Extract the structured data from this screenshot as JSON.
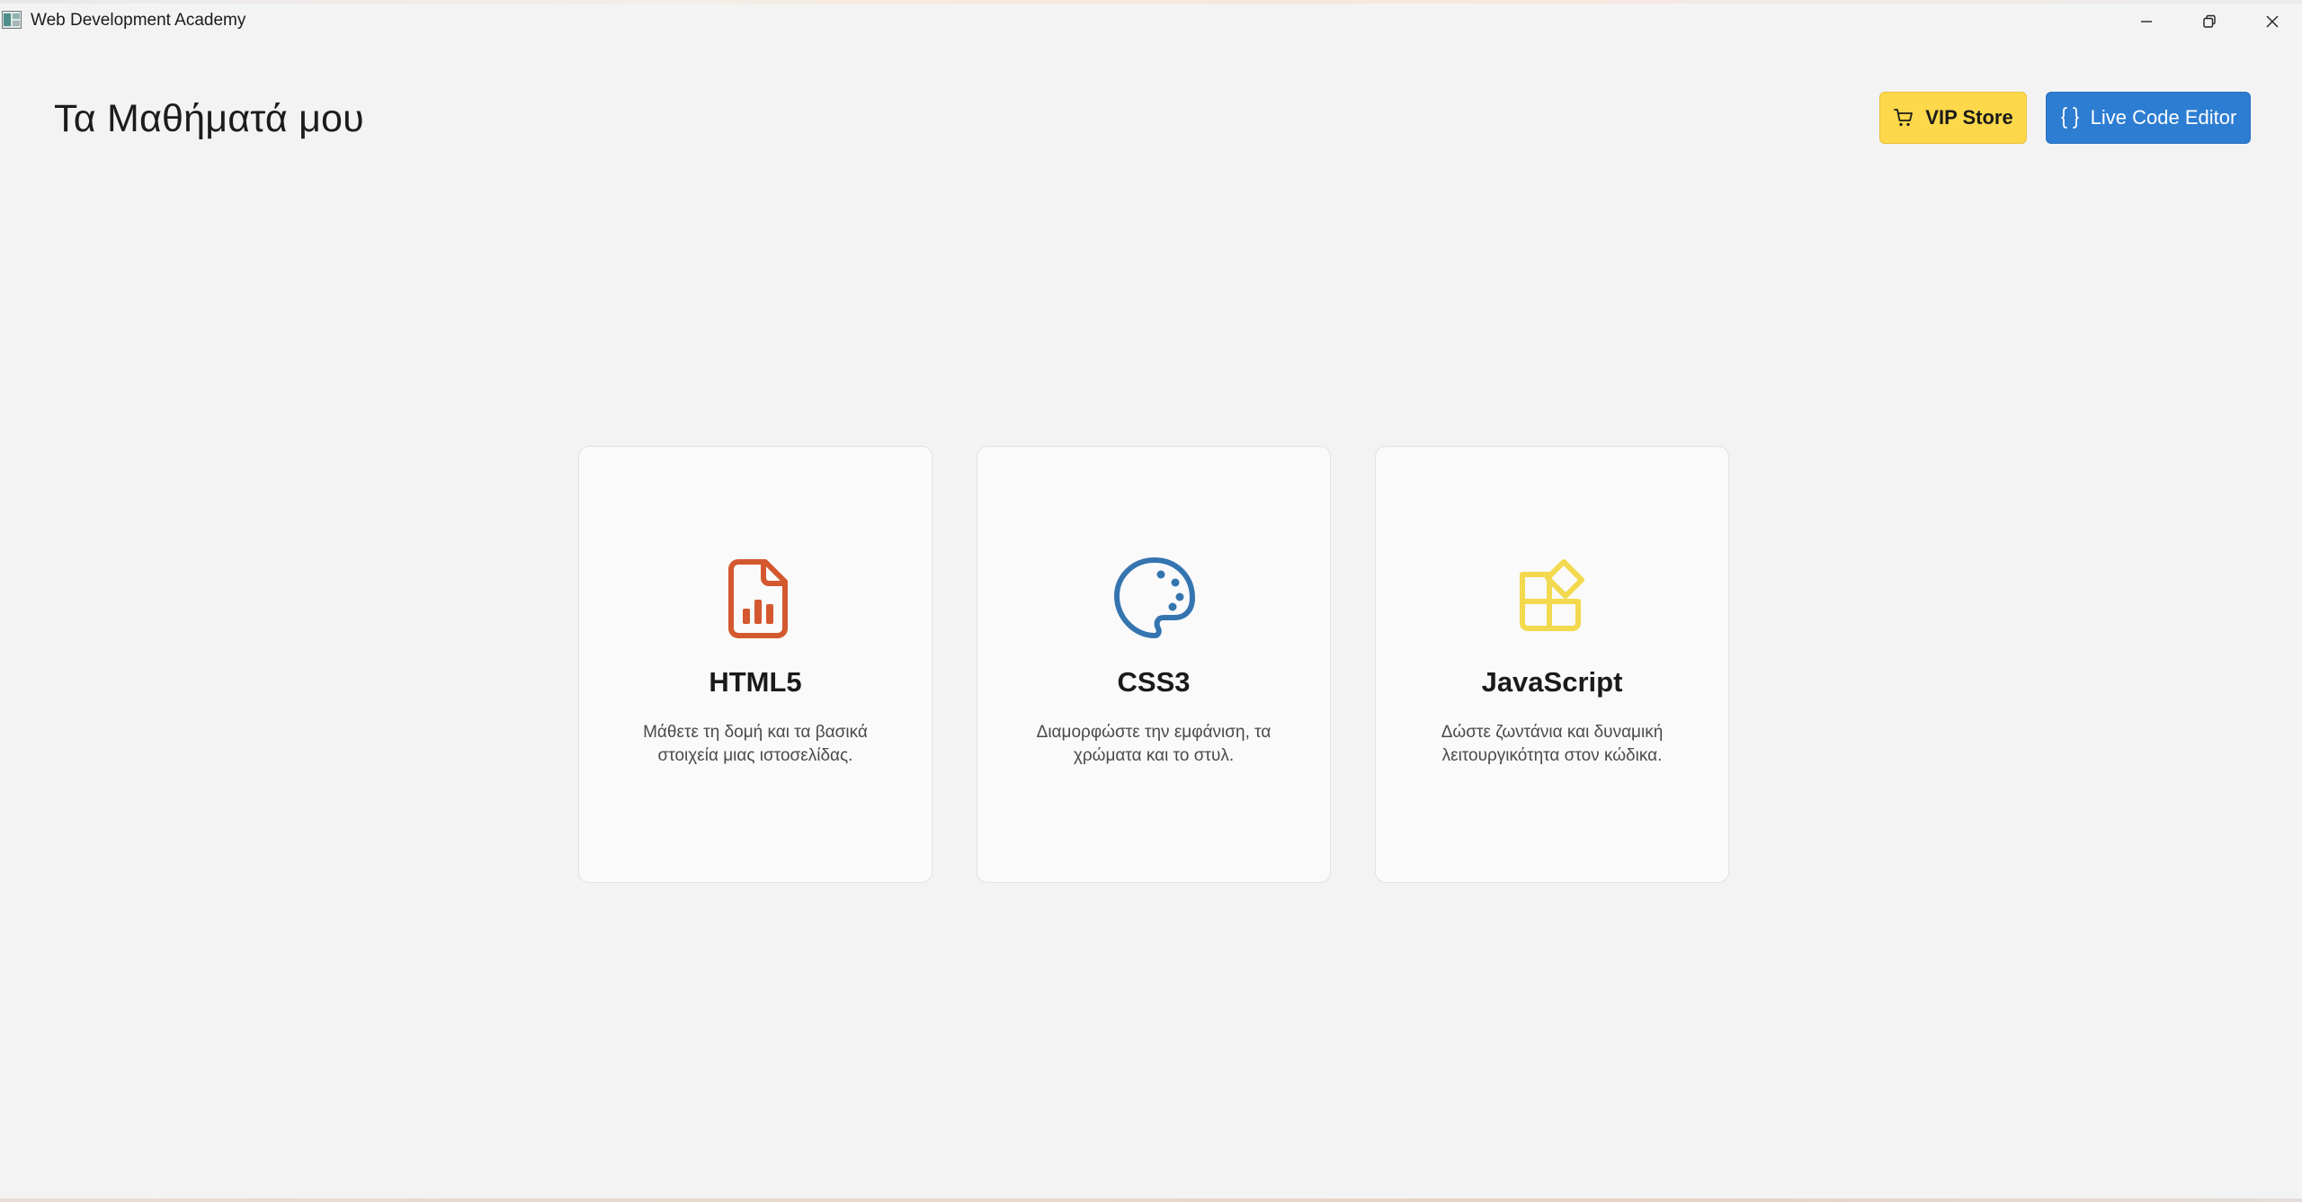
{
  "window": {
    "title": "Web Development Academy"
  },
  "header": {
    "title": "Τα Μαθήματά μου",
    "vip_button": {
      "label": "VIP Store",
      "icon": "cart-icon",
      "color": "#fcd84a"
    },
    "editor_button": {
      "label": "Live Code Editor",
      "icon": "braces-icon",
      "color": "#2d7dd2"
    }
  },
  "courses": [
    {
      "title": "HTML5",
      "description": "Μάθετε τη δομή και τα βασικά στοιχεία μιας ιστοσελίδας.",
      "icon": "document-chart-icon",
      "icon_color": "#d4582f"
    },
    {
      "title": "CSS3",
      "description": "Διαμορφώστε την εμφάνιση, τα χρώματα και το στυλ.",
      "icon": "palette-icon",
      "icon_color": "#3475b0"
    },
    {
      "title": "JavaScript",
      "description": "Δώστε ζωντάνια και δυναμική λειτουργικότητα στον κώδικα.",
      "icon": "apps-add-icon",
      "icon_color": "#f2d94e"
    }
  ]
}
